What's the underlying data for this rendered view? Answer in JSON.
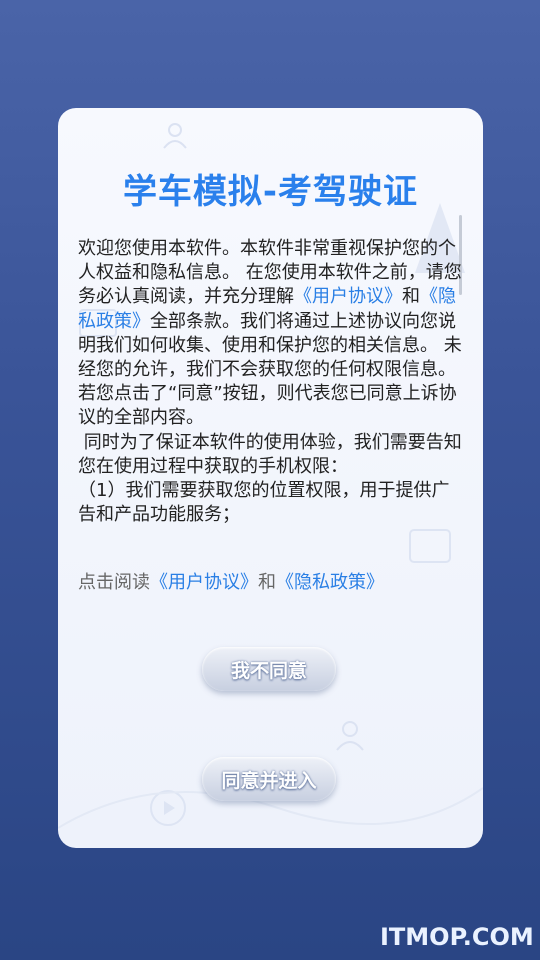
{
  "dialog": {
    "title": "学车模拟-考驾驶证",
    "para1_a": "欢迎您使用本软件。本软件非常重视保护您的个人权益和隐私信息。 在您使用本软件之前，请您务必认真阅读，并充分理解",
    "user_agreement": "《用户协议》",
    "and": "和",
    "privacy_policy": "《隐私政策》",
    "para1_b": "全部条款。我们将通过上述协议向您说明我们如何收集、使用和保护您的相关信息。 未经您的允许，我们不会获取您的任何权限信息。若您点击了“同意”按钮，则代表您已同意上诉协议的全部内容。",
    "para2": " 同时为了保证本软件的使用体验，我们需要告知您在使用过程中获取的手机权限：",
    "para3": "（1）我们需要获取您的位置权限，用于提供广告和产品功能服务；",
    "read_prefix": "点击阅读",
    "read_user_agreement": "《用户协议》",
    "read_and": "和",
    "read_privacy_policy": "《隐私政策》",
    "disagree_label": "我不同意",
    "agree_label": "同意并进入"
  },
  "watermark": "ITMOP.COM",
  "colors": {
    "accent": "#2a80ec",
    "link": "#2a7fe5",
    "background": "#3a5498"
  }
}
